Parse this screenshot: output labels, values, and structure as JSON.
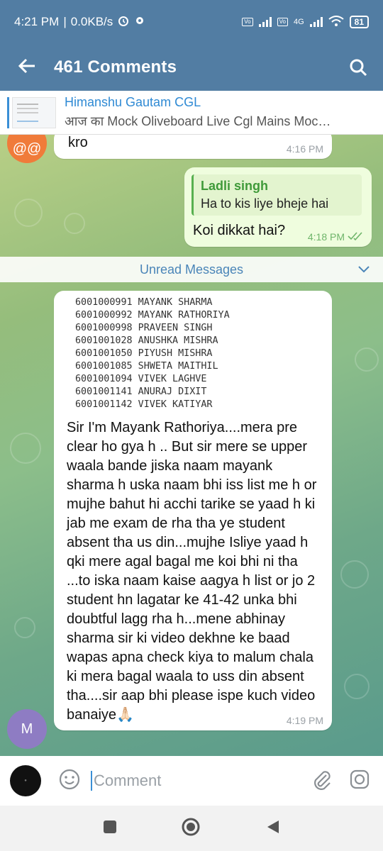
{
  "status": {
    "time": "4:21 PM",
    "speed": "0.0KB/s",
    "net": "4G",
    "battery": "81"
  },
  "header": {
    "title": "461 Comments"
  },
  "pinned": {
    "name": "Himanshu Gautam CGL",
    "text": "आज का Mock Oliveboard Live Cgl Mains Moc…"
  },
  "messages": {
    "top": {
      "avatar": "@@",
      "text": "kro",
      "time": "4:16 PM"
    },
    "reply_msg": {
      "reply_name": "Ladli singh",
      "reply_text": "Ha to  kis liye bheje hai",
      "text": "Koi dikkat hai?",
      "time": "4:18 PM"
    },
    "unread_label": "Unread Messages",
    "main": {
      "avatar": "M",
      "list": [
        "6001000991 MAYANK SHARMA",
        "6001000992 MAYANK RATHORIYA",
        "6001000998 PRAVEEN SINGH",
        "6001001028 ANUSHKA MISHRA",
        "6001001050 PIYUSH MISHRA",
        "6001001085 SHWETA MAITHIL",
        "6001001094 VIVEK LAGHVE",
        "6001001141 ANURAJ DIXIT",
        "6001001142 VIVEK KATIYAR"
      ],
      "text": "Sir I'm Mayank Rathoriya....mera pre clear ho gya h .. But sir mere se upper waala bande jiska naam mayank sharma h uska naam bhi iss list me h or mujhe bahut hi acchi tarike se yaad h ki jab me exam de rha tha ye student absent tha us din...mujhe Isliye yaad h qki mere agal bagal me koi bhi ni tha ...to iska naam kaise aagya h list or jo 2 student hn lagatar ke 41-42 unka bhi doubtful lagg rha h...mene abhinay sharma sir ki video dekhne ke baad wapas apna check kiya to malum chala ki mera bagal waala to uss din absent tha....sir aap bhi please ispe kuch video banaiye🙏🏻",
      "time": "4:19 PM"
    }
  },
  "composer": {
    "placeholder": "Comment"
  },
  "colors": {
    "header": "#527da3",
    "accent": "#3a8fd6",
    "outgoing": "#effdde"
  }
}
